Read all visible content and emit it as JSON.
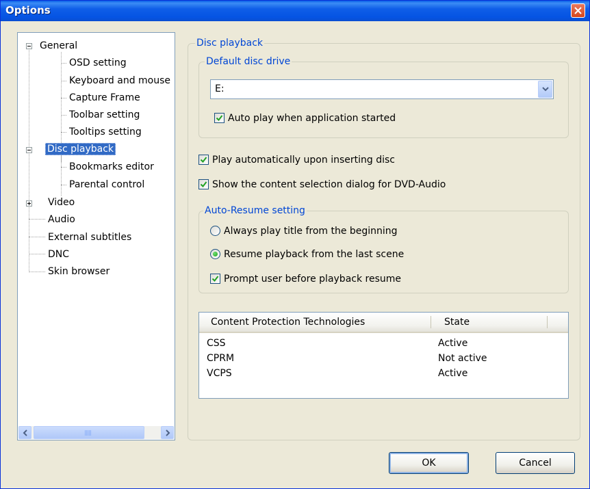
{
  "window": {
    "title": "Options"
  },
  "tree": {
    "items": [
      {
        "label": "General",
        "expander": "minus"
      },
      {
        "label": "OSD setting"
      },
      {
        "label": "Keyboard and mouse"
      },
      {
        "label": "Capture Frame"
      },
      {
        "label": "Toolbar setting"
      },
      {
        "label": "Tooltips setting"
      },
      {
        "label": "Disc playback",
        "expander": "minus",
        "selected": true
      },
      {
        "label": "Bookmarks editor"
      },
      {
        "label": "Parental control"
      },
      {
        "label": "Video",
        "expander": "plus"
      },
      {
        "label": "Audio"
      },
      {
        "label": "External subtitles"
      },
      {
        "label": "DNC"
      },
      {
        "label": "Skin browser"
      }
    ]
  },
  "disc_playback": {
    "group_label": "Disc playback",
    "default_drive": {
      "group_label": "Default disc drive",
      "selected_drive": "E:",
      "auto_play_label": "Auto play when application started",
      "auto_play_checked": true
    },
    "play_on_insert_label": "Play automatically upon inserting disc",
    "play_on_insert_checked": true,
    "show_dvd_audio_dialog_label": "Show the content selection dialog for DVD-Audio",
    "show_dvd_audio_dialog_checked": true,
    "auto_resume": {
      "group_label": "Auto-Resume setting",
      "option_beginning": "Always play title from the beginning",
      "option_last_scene": "Resume playback from the last scene",
      "selected": "last_scene",
      "prompt_label": "Prompt user before playback resume",
      "prompt_checked": true
    },
    "protection_table": {
      "columns": [
        "Content Protection Technologies",
        "State"
      ],
      "rows": [
        [
          "CSS",
          "Active"
        ],
        [
          "CPRM",
          "Not active"
        ],
        [
          "VCPS",
          "Active"
        ]
      ]
    }
  },
  "buttons": {
    "ok": "OK",
    "cancel": "Cancel"
  }
}
